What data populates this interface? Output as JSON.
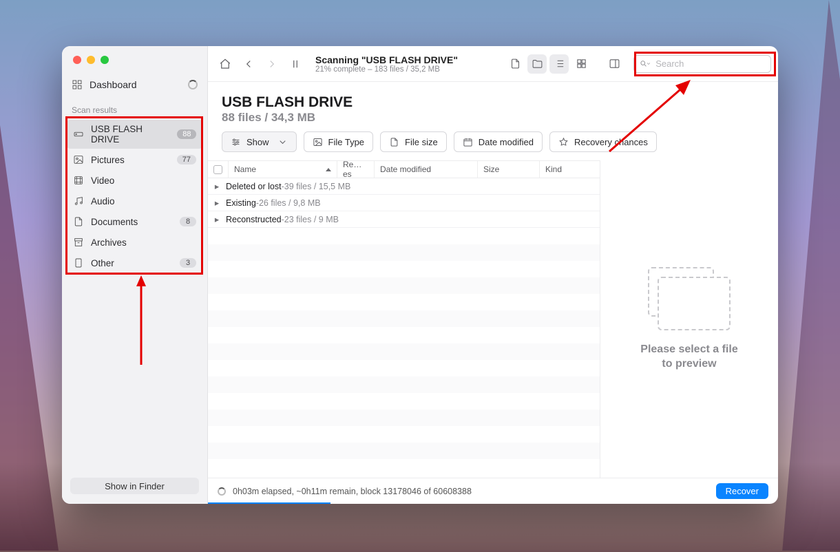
{
  "sidebar": {
    "dashboard_label": "Dashboard",
    "section_label": "Scan results",
    "items": [
      {
        "label": "USB FLASH DRIVE",
        "badge": "88",
        "icon": "hdd"
      },
      {
        "label": "Pictures",
        "badge": "77",
        "icon": "image"
      },
      {
        "label": "Video",
        "badge": "",
        "icon": "film"
      },
      {
        "label": "Audio",
        "badge": "",
        "icon": "music"
      },
      {
        "label": "Documents",
        "badge": "8",
        "icon": "doc"
      },
      {
        "label": "Archives",
        "badge": "",
        "icon": "archive"
      },
      {
        "label": "Other",
        "badge": "3",
        "icon": "other"
      }
    ],
    "show_in_finder": "Show in Finder"
  },
  "toolbar": {
    "scan_title": "Scanning \"USB FLASH DRIVE\"",
    "scan_sub": "21% complete – 183 files / 35,2 MB",
    "search_placeholder": "Search"
  },
  "title": {
    "main": "USB FLASH DRIVE",
    "sub": "88 files / 34,3 MB"
  },
  "filters": {
    "show": "Show",
    "file_type": "File Type",
    "file_size": "File size",
    "date_modified": "Date modified",
    "recovery": "Recovery chances"
  },
  "table": {
    "columns": {
      "name": "Name",
      "res": "Re…es",
      "date": "Date modified",
      "size": "Size",
      "kind": "Kind"
    },
    "groups": [
      {
        "name": "Deleted or lost",
        "sep": " - ",
        "meta": "39 files / 15,5 MB"
      },
      {
        "name": "Existing",
        "sep": " - ",
        "meta": "26 files / 9,8 MB"
      },
      {
        "name": "Reconstructed",
        "sep": " - ",
        "meta": "23 files / 9 MB"
      }
    ]
  },
  "preview": {
    "text": "Please select a file\nto preview"
  },
  "footer": {
    "status": "0h03m elapsed, ~0h11m remain, block 13178046 of 60608388",
    "recover": "Recover"
  }
}
